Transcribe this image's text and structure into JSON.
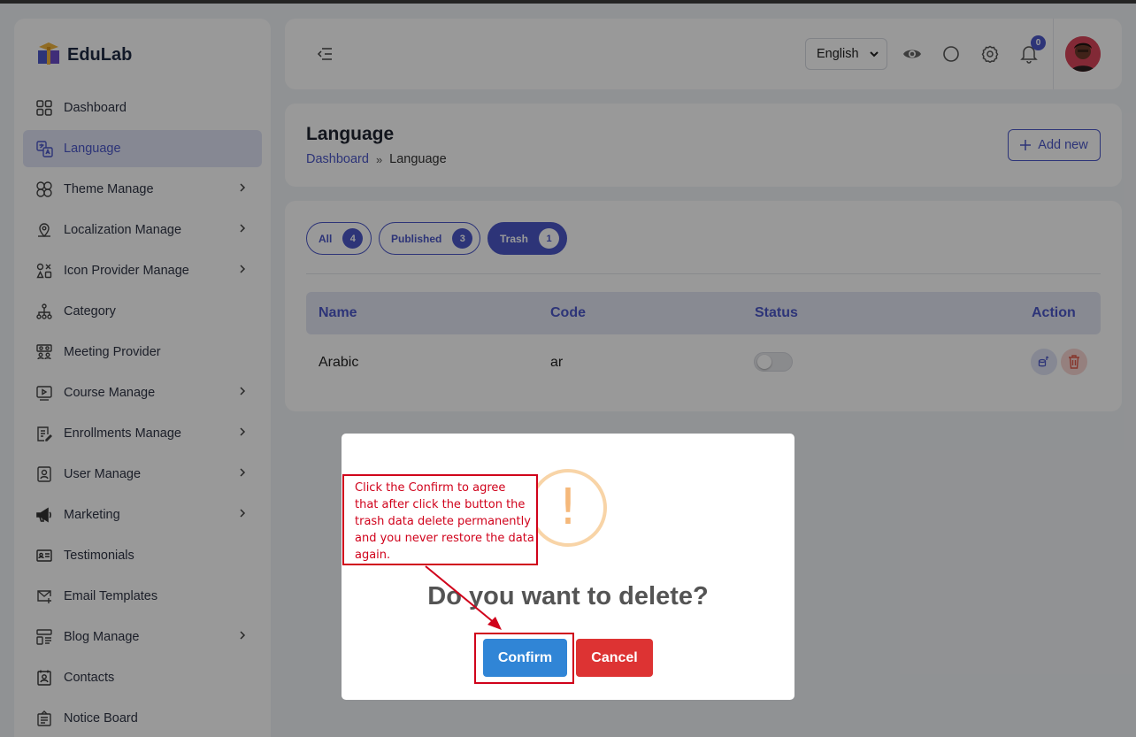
{
  "brand": {
    "name": "EduLab"
  },
  "sidebar": {
    "items": [
      {
        "label": "Dashboard",
        "icon": "grid-icon",
        "chevron": false,
        "active": false
      },
      {
        "label": "Language",
        "icon": "translate-icon",
        "chevron": false,
        "active": true
      },
      {
        "label": "Theme Manage",
        "icon": "clover-icon",
        "chevron": true,
        "active": false
      },
      {
        "label": "Localization Manage",
        "icon": "map-pin-icon",
        "chevron": true,
        "active": false
      },
      {
        "label": "Icon Provider Manage",
        "icon": "shapes-icon",
        "chevron": true,
        "active": false
      },
      {
        "label": "Category",
        "icon": "hierarchy-icon",
        "chevron": false,
        "active": false
      },
      {
        "label": "Meeting Provider",
        "icon": "users-icon",
        "chevron": false,
        "active": false
      },
      {
        "label": "Course Manage",
        "icon": "video-icon",
        "chevron": true,
        "active": false
      },
      {
        "label": "Enrollments Manage",
        "icon": "note-edit-icon",
        "chevron": true,
        "active": false
      },
      {
        "label": "User Manage",
        "icon": "user-square-icon",
        "chevron": true,
        "active": false
      },
      {
        "label": "Marketing",
        "icon": "megaphone-icon",
        "chevron": true,
        "active": false
      },
      {
        "label": "Testimonials",
        "icon": "id-card-icon",
        "chevron": false,
        "active": false
      },
      {
        "label": "Email Templates",
        "icon": "mail-plus-icon",
        "chevron": false,
        "active": false
      },
      {
        "label": "Blog Manage",
        "icon": "blog-layout-icon",
        "chevron": true,
        "active": false
      },
      {
        "label": "Contacts",
        "icon": "contact-book-icon",
        "chevron": false,
        "active": false
      },
      {
        "label": "Notice Board",
        "icon": "notice-icon",
        "chevron": false,
        "active": false
      }
    ]
  },
  "header": {
    "language_select": "English",
    "notification_count": "0"
  },
  "page": {
    "title": "Language",
    "breadcrumb": {
      "home": "Dashboard",
      "separator": "»",
      "current": "Language"
    },
    "add_new_label": "Add new"
  },
  "filters": [
    {
      "label": "All",
      "count": "4",
      "active": false
    },
    {
      "label": "Published",
      "count": "3",
      "active": false
    },
    {
      "label": "Trash",
      "count": "1",
      "active": true
    }
  ],
  "table": {
    "columns": [
      "Name",
      "Code",
      "Status",
      "Action"
    ],
    "rows": [
      {
        "name": "Arabic",
        "code": "ar",
        "status": false
      }
    ]
  },
  "modal": {
    "icon": "!",
    "title": "Do you want to delete?",
    "confirm_label": "Confirm",
    "cancel_label": "Cancel"
  },
  "annotation": {
    "lines": [
      "Click the Confirm to agree",
      "that after click the button the",
      "trash data delete permanently",
      "and you never restore the data",
      "again."
    ]
  },
  "colors": {
    "primary": "#4b57c8",
    "confirm": "#3085d6",
    "cancel": "#dd3333",
    "annotation": "#d0021b",
    "warning": "#f8bb86"
  }
}
